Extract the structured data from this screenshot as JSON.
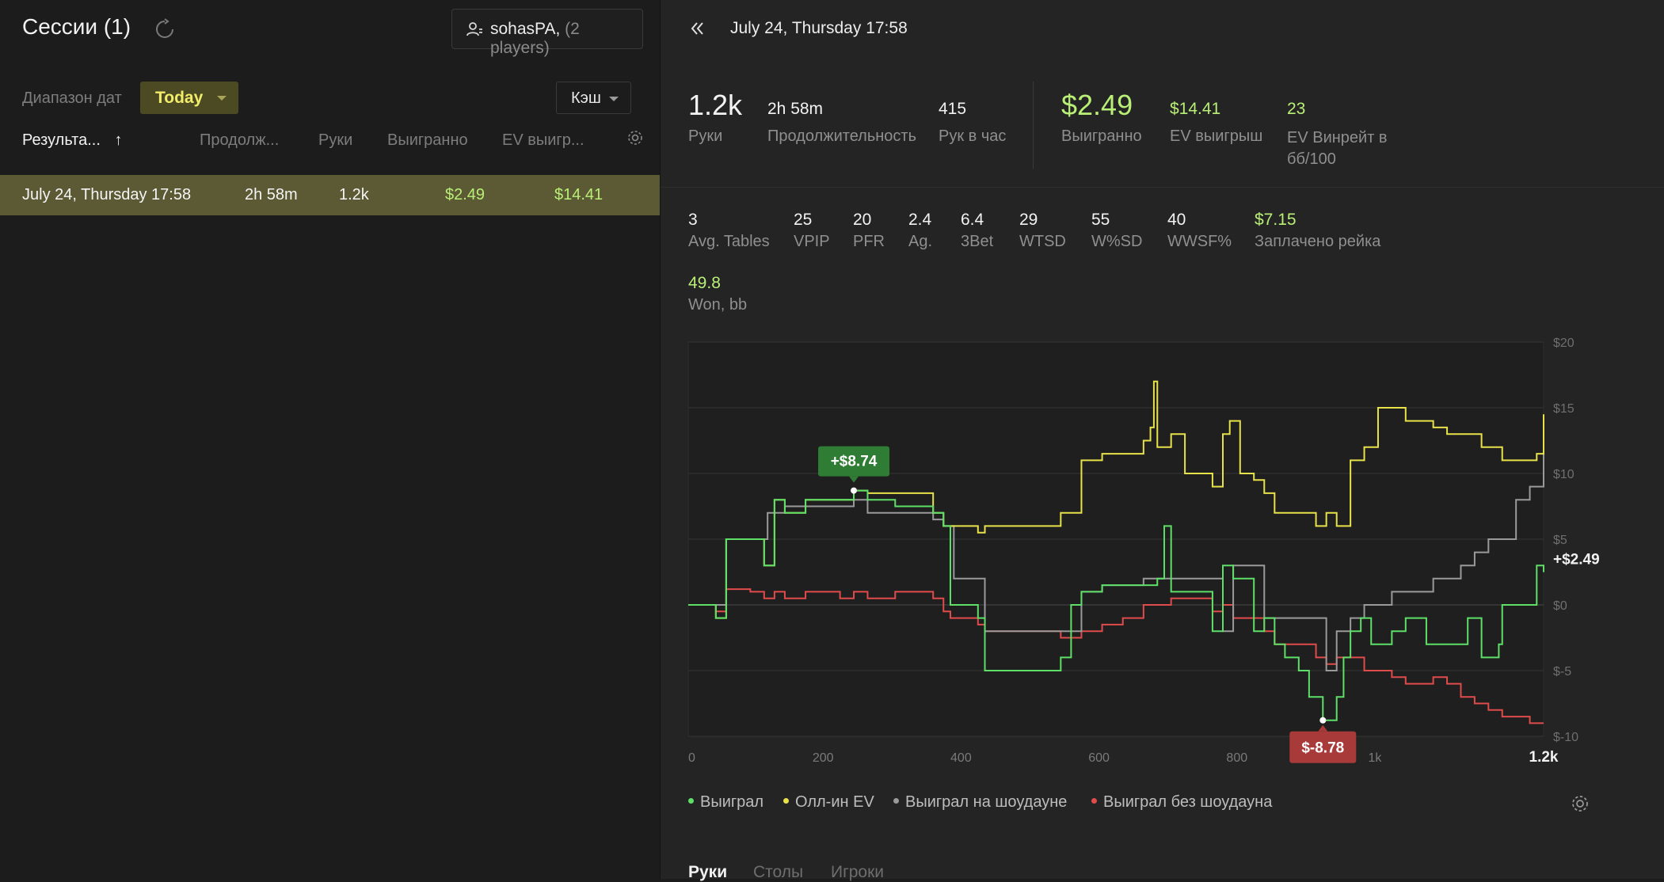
{
  "left": {
    "title": "Сессии (1)",
    "player": {
      "name": "sohasPA",
      "count": "(2 players)"
    },
    "range_label": "Диапазон дат",
    "range_value": "Today",
    "cash_label": "Кэш",
    "columns": [
      "Результа...",
      "Продолж...",
      "Руки",
      "Выигранно",
      "EV выигр..."
    ],
    "sort_arrow": "↑",
    "session": {
      "date": "July 24, Thursday 17:58",
      "duration": "2h 58m",
      "hands": "1.2k",
      "won": "$2.49",
      "ev_won": "$14.41"
    }
  },
  "right": {
    "header": "July 24, Thursday 17:58",
    "top_stats": [
      {
        "value": "1.2k",
        "label": "Руки"
      },
      {
        "value": "2h 58m",
        "label": "Продолжительность"
      },
      {
        "value": "415",
        "label": "Рук в час"
      },
      {
        "value": "$2.49",
        "label": "Выигранно"
      },
      {
        "value": "$14.41",
        "label": "EV выигрыш"
      },
      {
        "value": "23",
        "label": "EV Винрейт в бб/100"
      }
    ],
    "second_stats": [
      {
        "value": "3",
        "label": "Avg. Tables"
      },
      {
        "value": "25",
        "label": "VPIP"
      },
      {
        "value": "20",
        "label": "PFR"
      },
      {
        "value": "2.4",
        "label": "Ag."
      },
      {
        "value": "6.4",
        "label": "3Bet"
      },
      {
        "value": "29",
        "label": "WTSD"
      },
      {
        "value": "55",
        "label": "W%SD"
      },
      {
        "value": "40",
        "label": "WWSF%"
      },
      {
        "value": "$7.15",
        "label": "Заплачено рейка"
      }
    ],
    "third_stats": [
      {
        "value": "49.8",
        "label": "Won, bb"
      }
    ],
    "legend": [
      {
        "label": "Выиграл",
        "color": "#5ee068"
      },
      {
        "label": "Олл-ин EV",
        "color": "#e8e24a"
      },
      {
        "label": "Выиграл на шоудауне",
        "color": "#9a9a9a"
      },
      {
        "label": "Выиграл без шоудауна",
        "color": "#e04b4b"
      }
    ],
    "tabs": [
      "Руки",
      "Столы",
      "Игроки"
    ]
  },
  "chart_data": {
    "type": "line",
    "y_ticks": [
      "$20",
      "$15",
      "$10",
      "$5",
      "$0",
      "$-5",
      "$-10"
    ],
    "x_ticks": [
      "0",
      "200",
      "400",
      "600",
      "800",
      "1k",
      "1.2k"
    ],
    "ylim": [
      -10,
      20
    ],
    "xlim": [
      0,
      1240
    ],
    "max_label": "+$8.74",
    "min_label": "$-8.78",
    "end_label": "+$2.49",
    "series": [
      {
        "name": "Выиграл",
        "color": "#5ee068",
        "x": [
          0,
          30,
          40,
          55,
          90,
          110,
          115,
          125,
          140,
          170,
          220,
          240,
          260,
          300,
          355,
          370,
          380,
          420,
          430,
          540,
          555,
          570,
          600,
          680,
          690,
          700,
          760,
          775,
          790,
          820,
          835,
          850,
          865,
          885,
          900,
          920,
          940,
          950,
          960,
          975,
          990,
          1020,
          1040,
          1070,
          1110,
          1130,
          1140,
          1150,
          1175,
          1180,
          1200,
          1215,
          1230,
          1240
        ],
        "y": [
          0,
          0,
          -1,
          5,
          5,
          3,
          3,
          8,
          7,
          8,
          8,
          8.7,
          8,
          7.5,
          7,
          6,
          0,
          -1,
          -5,
          -4,
          0,
          1,
          1.5,
          2,
          6,
          1,
          -2,
          3,
          2,
          -2,
          -1,
          -3,
          -4,
          -5,
          -7,
          -8.78,
          -7,
          -4,
          -2,
          -1,
          -3,
          -2,
          -1,
          -3,
          -3,
          -1,
          -1,
          -4,
          -3,
          0,
          0,
          0,
          3,
          2.49
        ]
      },
      {
        "name": "Олл-ин EV",
        "color": "#e8e24a",
        "x": [
          0,
          30,
          40,
          55,
          90,
          110,
          115,
          125,
          140,
          170,
          220,
          240,
          260,
          300,
          355,
          370,
          380,
          420,
          430,
          540,
          555,
          570,
          600,
          660,
          670,
          675,
          680,
          700,
          720,
          760,
          775,
          785,
          800,
          820,
          835,
          850,
          880,
          910,
          925,
          940,
          960,
          980,
          1000,
          1020,
          1040,
          1080,
          1100,
          1150,
          1180,
          1200,
          1230,
          1240
        ],
        "y": [
          0,
          0,
          -1,
          5,
          5,
          3,
          3,
          8,
          7,
          8,
          8,
          8.7,
          8.5,
          8.5,
          7,
          6,
          6,
          5.5,
          6,
          7,
          7,
          11,
          11.5,
          12.5,
          13.5,
          17,
          12,
          13,
          10,
          9,
          13,
          14,
          10,
          9.5,
          8.5,
          7,
          7,
          6,
          7,
          6,
          11,
          12,
          15,
          15,
          14,
          13.5,
          13,
          12,
          11,
          11,
          11.5,
          14.5
        ]
      },
      {
        "name": "Выиграл на шоудауне",
        "color": "#9a9a9a",
        "x": [
          0,
          40,
          55,
          90,
          115,
          125,
          140,
          170,
          220,
          240,
          260,
          300,
          355,
          370,
          385,
          420,
          430,
          540,
          570,
          600,
          630,
          660,
          680,
          700,
          760,
          775,
          790,
          820,
          835,
          850,
          880,
          910,
          925,
          940,
          960,
          980,
          1020,
          1060,
          1080,
          1100,
          1120,
          1140,
          1160,
          1180,
          1200,
          1220,
          1240
        ],
        "y": [
          0,
          0,
          5,
          5,
          7,
          7,
          7.5,
          7.5,
          7.5,
          8,
          7,
          7,
          6.5,
          6,
          2,
          2,
          -2,
          -2,
          1,
          1.5,
          1.5,
          2,
          2,
          2,
          2,
          -2,
          3,
          3,
          -1,
          -1,
          -1,
          -1,
          -5,
          -2,
          -1,
          0,
          1,
          1,
          2,
          2,
          3,
          4,
          5,
          5,
          8,
          9,
          11.5
        ]
      },
      {
        "name": "Выиграл без шоудауна",
        "color": "#e04b4b",
        "x": [
          0,
          40,
          55,
          90,
          110,
          115,
          125,
          140,
          170,
          220,
          240,
          260,
          300,
          355,
          370,
          380,
          420,
          430,
          540,
          570,
          600,
          630,
          660,
          700,
          760,
          775,
          790,
          820,
          835,
          850,
          880,
          910,
          925,
          940,
          960,
          980,
          1000,
          1020,
          1040,
          1060,
          1080,
          1100,
          1120,
          1140,
          1160,
          1180,
          1200,
          1220,
          1240
        ],
        "y": [
          0,
          -0.5,
          1.2,
          1,
          0.5,
          0.5,
          1,
          0.5,
          1,
          0.5,
          1,
          0.5,
          1,
          0.5,
          -0.5,
          -1,
          -1.5,
          -2,
          -2.5,
          -2,
          -1.5,
          -1,
          0,
          0.5,
          -0.5,
          0,
          -1,
          -1,
          -2,
          -3,
          -3,
          -4,
          -4.5,
          -4,
          -4,
          -5,
          -5,
          -5.5,
          -6,
          -6,
          -5.5,
          -6,
          -7,
          -7.5,
          -8,
          -8.5,
          -8.5,
          -9,
          -9
        ]
      }
    ]
  }
}
